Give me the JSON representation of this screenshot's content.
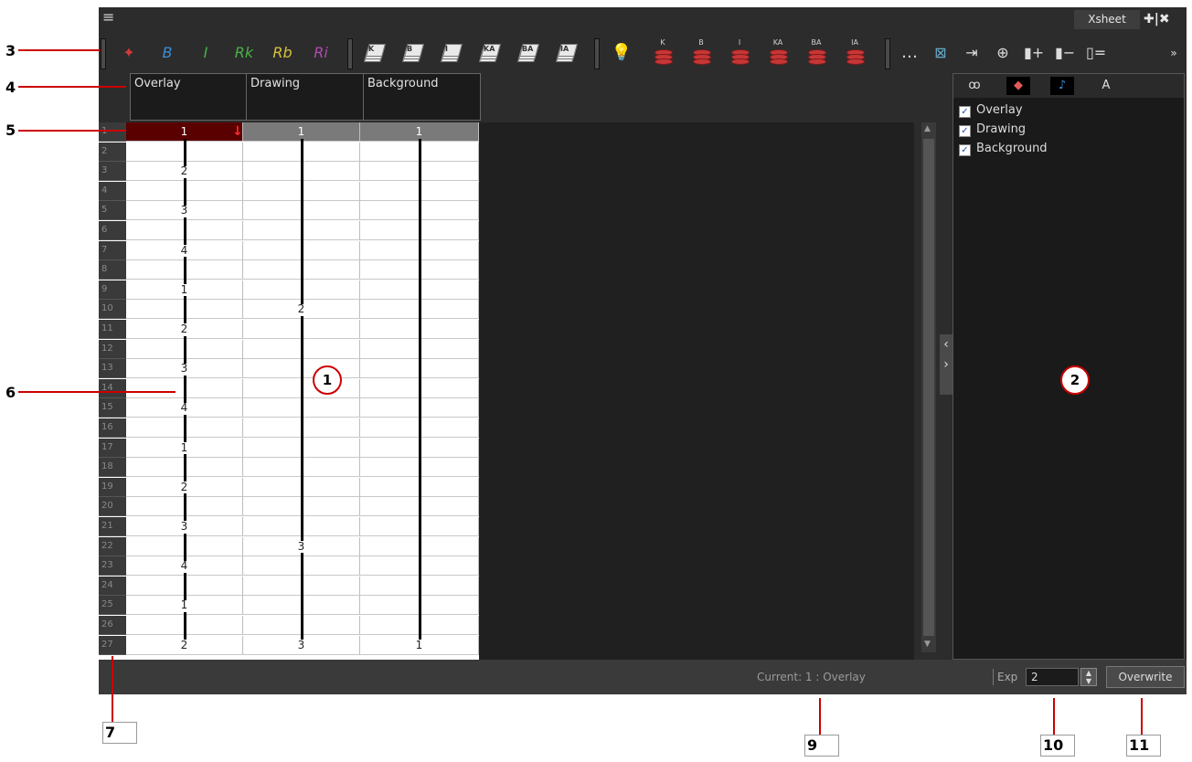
{
  "window": {
    "tab_label": "Xsheet",
    "menu_glyph": "≡",
    "title_icons": "✚|✖"
  },
  "toolbar": {
    "color_tools": [
      {
        "glyph": "✦",
        "name": "recolor-icon",
        "color": "#d23a3a"
      },
      {
        "glyph": "B",
        "name": "brush-b-icon",
        "color": "#3a8fd8"
      },
      {
        "glyph": "I",
        "name": "brush-i-icon",
        "color": "#4ab04a"
      },
      {
        "glyph": "Rk",
        "name": "rk-icon",
        "color": "#4ab04a"
      },
      {
        "glyph": "Rb",
        "name": "rb-icon",
        "color": "#d8c23a"
      },
      {
        "glyph": "Ri",
        "name": "ri-icon",
        "color": "#b04ab0"
      }
    ],
    "drawing_stack_labels": [
      "K",
      "B",
      "I",
      "KA",
      "BA",
      "IA"
    ],
    "layer_stack_labels": [
      "K",
      "B",
      "I",
      "KA",
      "BA",
      "IA"
    ],
    "more_glyph": "…",
    "overflow_glyph": "»"
  },
  "columns": [
    {
      "name": "Overlay"
    },
    {
      "name": "Drawing"
    },
    {
      "name": "Background"
    }
  ],
  "frames": [
    "1",
    "2",
    "3",
    "4",
    "5",
    "6",
    "7",
    "8",
    "9",
    "10",
    "11",
    "12",
    "13",
    "14",
    "15",
    "16",
    "17",
    "18",
    "19",
    "20",
    "21",
    "22",
    "23",
    "24",
    "25",
    "26",
    "27"
  ],
  "cells": {
    "overlay": [
      "1",
      "",
      "2",
      "",
      "3",
      "",
      "4",
      "",
      "1",
      "",
      "2",
      "",
      "3",
      "",
      "4",
      "",
      "1",
      "",
      "2",
      "",
      "3",
      "",
      "4",
      "",
      "1",
      "",
      "2"
    ],
    "drawing": [
      "1",
      "",
      "",
      "",
      "",
      "",
      "",
      "",
      "",
      "2",
      "",
      "",
      "",
      "",
      "",
      "",
      "",
      "",
      "",
      "",
      "",
      "3",
      "",
      "",
      "",
      "",
      "3"
    ],
    "background": [
      "1",
      "",
      "",
      "",
      "",
      "",
      "",
      "",
      "",
      "",
      "",
      "",
      "",
      "",
      "",
      "",
      "",
      "",
      "",
      "",
      "",
      "",
      "",
      "",
      "",
      "",
      "1"
    ]
  },
  "current_marker": "↓",
  "right_panel": {
    "tab_glyphs": [
      "ꝏ",
      "◆",
      "♪",
      "A"
    ],
    "tab_names": [
      "thumbnails-tab-icon",
      "colors-tab-icon",
      "sound-tab-icon",
      "annotation-tab-icon"
    ],
    "layers": [
      {
        "label": "Overlay",
        "checked": true
      },
      {
        "label": "Drawing",
        "checked": true
      },
      {
        "label": "Background",
        "checked": true
      }
    ],
    "check_glyph": "✓"
  },
  "status": {
    "current": "Current: 1 : Overlay",
    "exp_label": "Exp",
    "exp_value": "2",
    "overwrite_label": "Overwrite"
  },
  "callouts": {
    "left": [
      "3",
      "4",
      "5",
      "6"
    ],
    "bottom": [
      "7",
      "9",
      "10",
      "11"
    ],
    "circles": [
      "1",
      "2"
    ]
  },
  "colors": {
    "current_cell": "#5a0000",
    "marker": "#ff2a2a",
    "callout_line": "#cc0000"
  }
}
